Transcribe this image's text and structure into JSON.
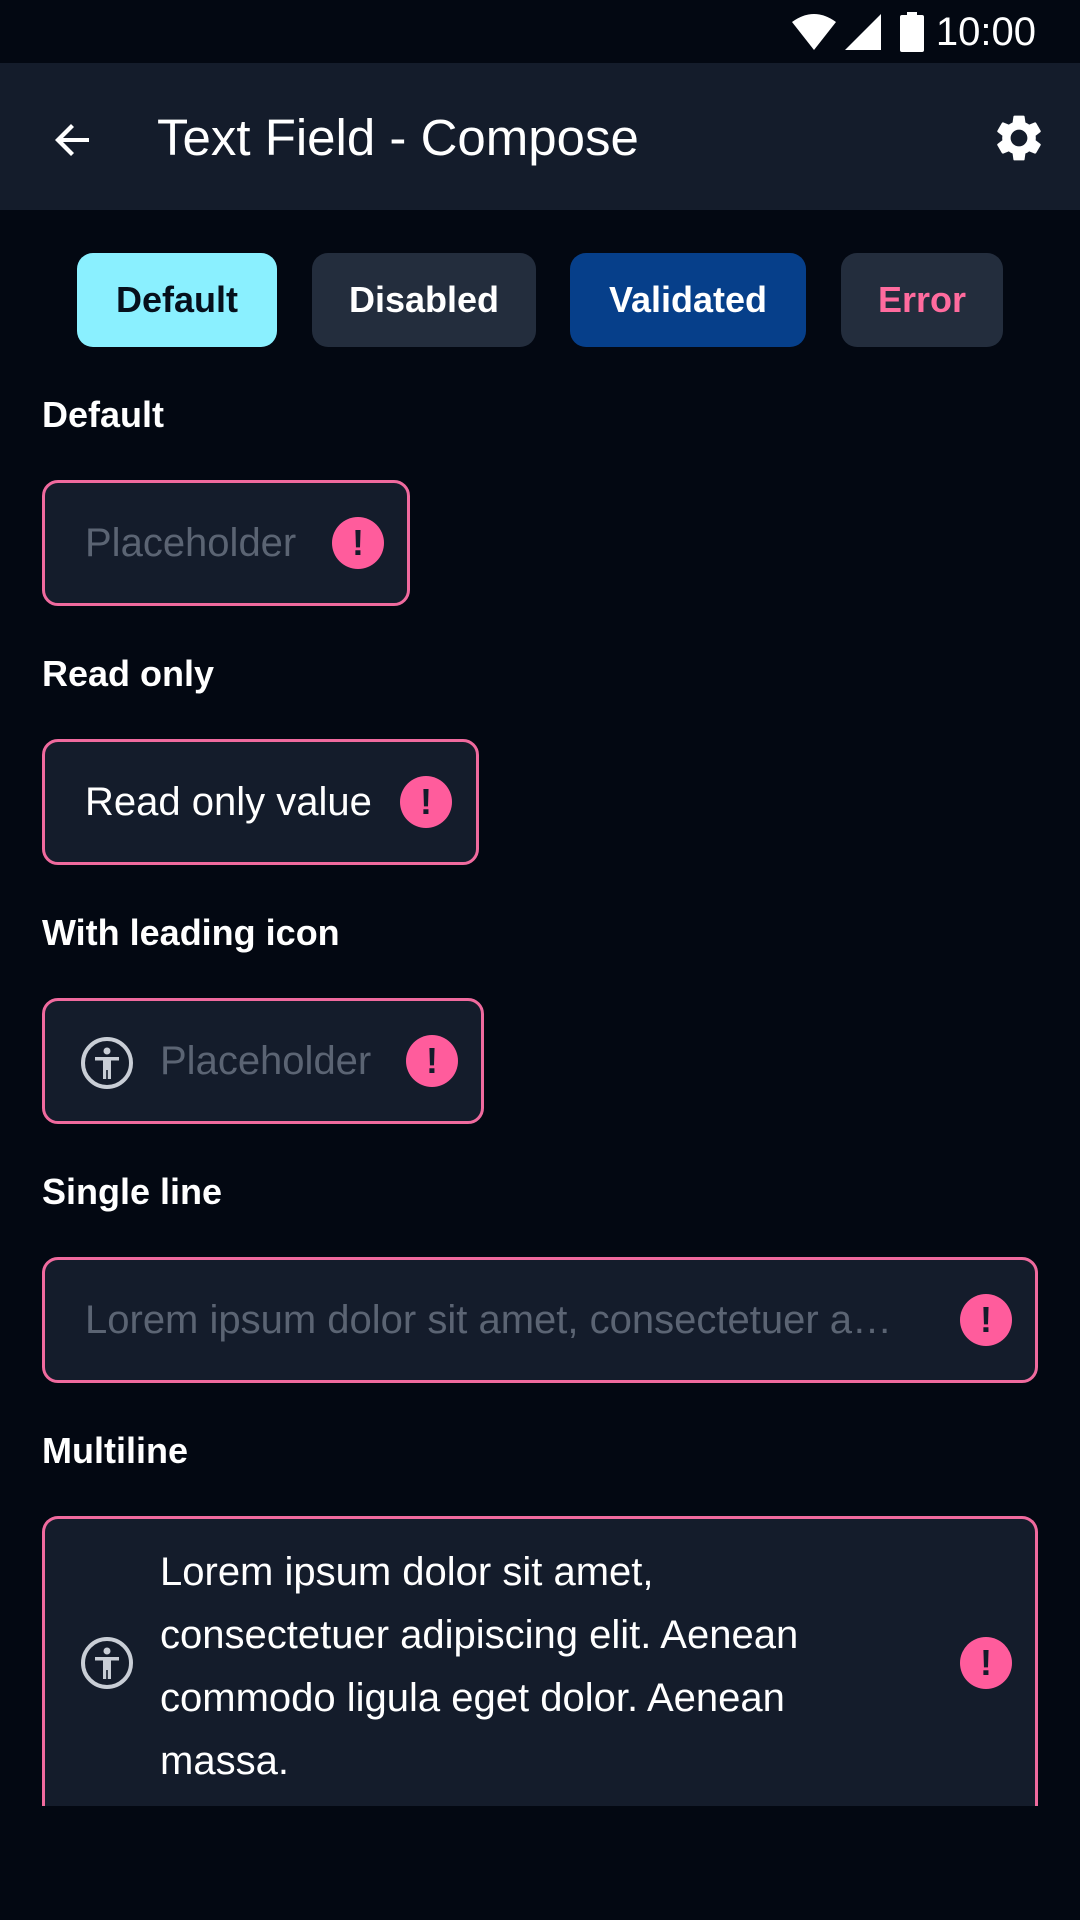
{
  "status_bar": {
    "time": "10:00",
    "icons": [
      "wifi-icon",
      "signal-icon",
      "battery-icon"
    ]
  },
  "app_bar": {
    "title": "Text Field - Compose",
    "back_icon": "arrow-back-icon",
    "settings_icon": "gear-icon"
  },
  "tabs": [
    {
      "label": "Default",
      "selected": true
    },
    {
      "label": "Disabled",
      "selected": false
    },
    {
      "label": "Validated",
      "selected": false
    },
    {
      "label": "Error",
      "selected": false
    }
  ],
  "sections": {
    "default": {
      "label": "Default",
      "placeholder": "Placeholder"
    },
    "read_only": {
      "label": "Read only",
      "value": "Read only value"
    },
    "leading_icon": {
      "label": "With leading icon",
      "placeholder": "Placeholder",
      "icon": "accessibility-icon"
    },
    "single_line": {
      "label": "Single line",
      "placeholder": "Lorem ipsum dolor sit amet, consectetuer a…"
    },
    "multiline": {
      "label": "Multiline",
      "value": "Lorem ipsum dolor sit amet, consectetuer adipiscing elit. Aenean commodo ligula eget dolor. Aenean massa.",
      "icon": "accessibility-icon"
    }
  },
  "colors": {
    "background": "#030812",
    "app_bar": "#141c2b",
    "error_border": "#f06a9e",
    "error_icon": "#ff5c9c",
    "chip_selected": "#8af0ff",
    "chip_validated": "#063f8a",
    "chip_error_text": "#ff6b9e"
  }
}
